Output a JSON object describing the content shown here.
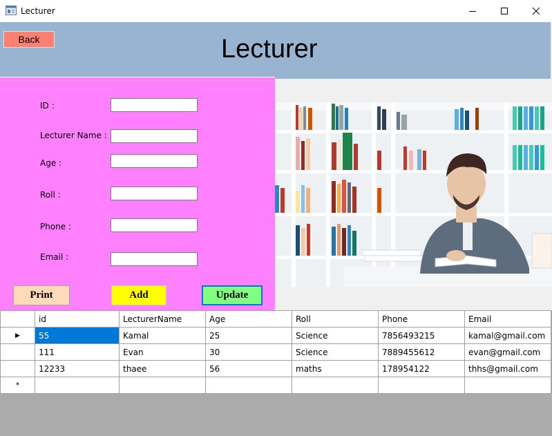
{
  "window": {
    "title": "Lecturer"
  },
  "header": {
    "back_label": "Back",
    "title": "Lecturer"
  },
  "form": {
    "id_label": "ID :",
    "name_label": "Lecturer Name :",
    "age_label": "Age :",
    "roll_label": "Roll :",
    "phone_label": "Phone :",
    "email_label": "Email :",
    "id_value": "",
    "name_value": "",
    "age_value": "",
    "roll_value": "",
    "phone_value": "",
    "email_value": "",
    "print_label": "Print",
    "add_label": "Add",
    "update_label": "Update"
  },
  "colors": {
    "header_bg": "#99b4d1",
    "form_bg": "#ff80ff",
    "back_btn": "#fa8072",
    "print_btn": "#ffdab9",
    "add_btn": "#ffff00",
    "update_btn": "#80ff80",
    "selection": "#0078d7"
  },
  "grid": {
    "columns": [
      "id",
      "LecturerName",
      "Age",
      "Roll",
      "Phone",
      "Email"
    ],
    "rows": [
      [
        "55",
        "Kamal",
        "25",
        "Science",
        "7856493215",
        "kamal@gmail.com"
      ],
      [
        "111",
        "Evan",
        "30",
        "Science",
        "7889455612",
        "evan@gmail.com"
      ],
      [
        "12233",
        "thaee",
        "56",
        "maths",
        "178954122",
        "thhs@gmail.com"
      ]
    ],
    "current_row_marker": "▶",
    "new_row_marker": "*"
  }
}
